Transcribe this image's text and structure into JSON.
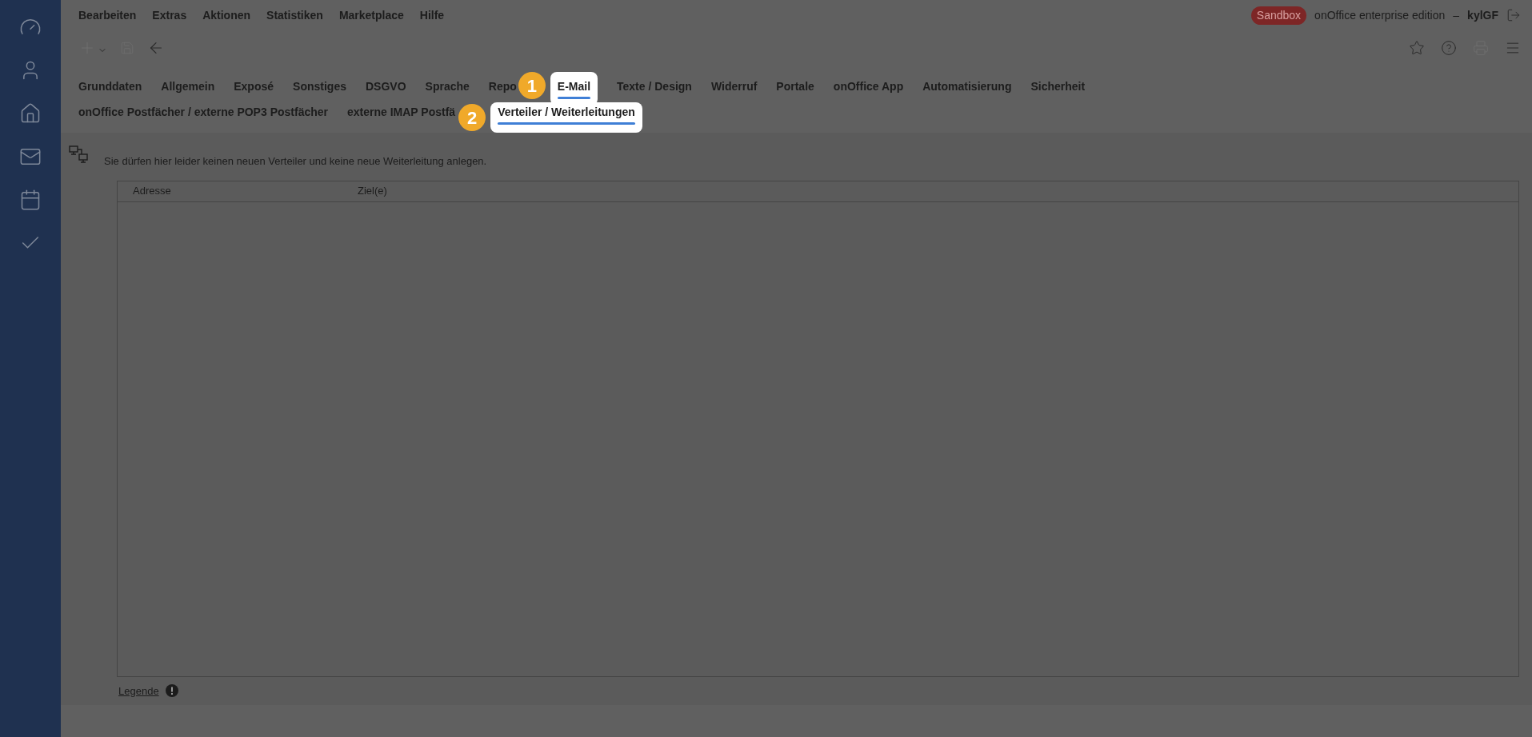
{
  "menu": [
    "Bearbeiten",
    "Extras",
    "Aktionen",
    "Statistiken",
    "Marketplace",
    "Hilfe"
  ],
  "header": {
    "badge": "Sandbox",
    "edition": "onOffice enterprise edition",
    "separator": "–",
    "user": "kylGF"
  },
  "tabs": [
    {
      "label": "Grunddaten",
      "selected": false
    },
    {
      "label": "Allgemein",
      "selected": false
    },
    {
      "label": "Exposé",
      "selected": false
    },
    {
      "label": "Sonstiges",
      "selected": false
    },
    {
      "label": "DSGVO",
      "selected": false
    },
    {
      "label": "Sprache",
      "selected": false
    },
    {
      "label": "Repo",
      "selected": false
    },
    {
      "label": "E-Mail",
      "selected": true,
      "step": "1"
    },
    {
      "label": "Texte / Design",
      "selected": false
    },
    {
      "label": "Widerruf",
      "selected": false
    },
    {
      "label": "Portale",
      "selected": false
    },
    {
      "label": "onOffice App",
      "selected": false
    },
    {
      "label": "Automatisierung",
      "selected": false
    },
    {
      "label": "Sicherheit",
      "selected": false
    }
  ],
  "subtabs": [
    {
      "label": "onOffice Postfächer / externe POP3 Postfächer",
      "selected": false
    },
    {
      "label": "externe IMAP Postfä",
      "selected": false
    },
    {
      "label": "Verteiler / Weiterleitungen",
      "selected": true,
      "step": "2"
    }
  ],
  "notice": "Sie dürfen hier leider keinen neuen Verteiler und keine neue Weiterleitung anlegen.",
  "table": {
    "columns": [
      "Adresse",
      "Ziel(e)"
    ]
  },
  "legend": "Legende"
}
